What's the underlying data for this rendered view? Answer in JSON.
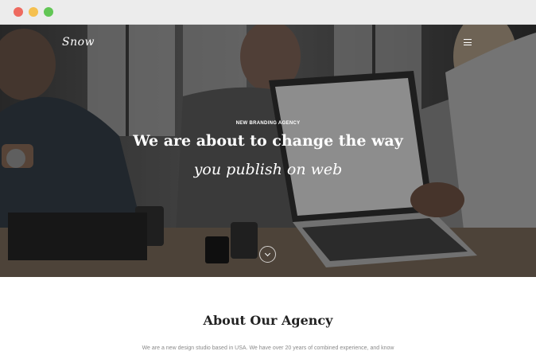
{
  "window": {
    "controls": [
      "close",
      "minimize",
      "maximize"
    ],
    "colors": {
      "close": "#ee6a5f",
      "minimize": "#f5c04f",
      "maximize": "#62c655"
    }
  },
  "header": {
    "logo": "Snow",
    "menu_icon": "hamburger-menu-icon"
  },
  "hero": {
    "eyebrow": "NEW BRANDING AGENCY",
    "headline": "We are about to change the way",
    "subheadline": "you publish on web",
    "scroll_icon": "chevron-down-icon"
  },
  "about": {
    "title": "About Our Agency",
    "text": "We are a new design studio based in USA. We have over 20 years of combined experience, and know"
  }
}
